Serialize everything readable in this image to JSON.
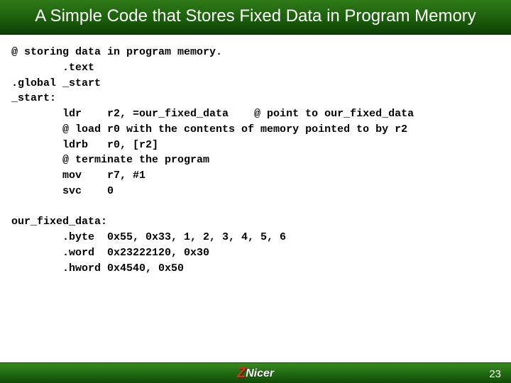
{
  "title": "A Simple Code that Stores Fixed Data in Program Memory",
  "code": "@ storing data in program memory.\n        .text\n.global _start\n_start:\n        ldr    r2, =our_fixed_data    @ point to our_fixed_data\n        @ load r0 with the contents of memory pointed to by r2\n        ldrb   r0, [r2]\n        @ terminate the program\n        mov    r7, #1\n        svc    0\n\nour_fixed_data:\n        .byte  0x55, 0x33, 1, 2, 3, 4, 5, 6\n        .word  0x23222120, 0x30\n        .hword 0x4540, 0x50",
  "logo": {
    "z": "Z",
    "nicer": "Nicer"
  },
  "page_number": "23"
}
